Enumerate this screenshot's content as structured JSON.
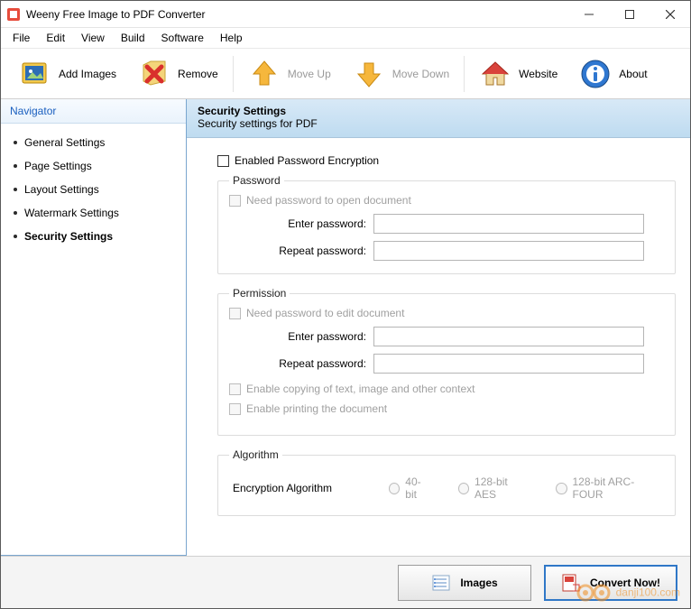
{
  "window": {
    "title": "Weeny Free Image to PDF Converter"
  },
  "menu": {
    "items": [
      "File",
      "Edit",
      "View",
      "Build",
      "Software",
      "Help"
    ]
  },
  "toolbar": {
    "add": "Add Images",
    "remove": "Remove",
    "moveup": "Move Up",
    "movedown": "Move Down",
    "website": "Website",
    "about": "About"
  },
  "sidebar": {
    "header": "Navigator",
    "items": [
      "General Settings",
      "Page Settings",
      "Layout Settings",
      "Watermark Settings",
      "Security Settings"
    ],
    "active": 4
  },
  "panel": {
    "title": "Security Settings",
    "subtitle": "Security settings for PDF",
    "enable_encryption": "Enabled Password Encryption",
    "password": {
      "legend": "Password",
      "need_open": "Need password to open document",
      "enter": "Enter password:",
      "repeat": "Repeat password:"
    },
    "permission": {
      "legend": "Permission",
      "need_edit": "Need password to edit document",
      "enter": "Enter password:",
      "repeat": "Repeat password:",
      "copy": "Enable copying of text, image and other context",
      "print": "Enable printing the document"
    },
    "algorithm": {
      "legend": "Algorithm",
      "label": "Encryption Algorithm",
      "options": [
        "40-bit",
        "128-bit AES",
        "128-bit ARC-FOUR"
      ]
    }
  },
  "footer": {
    "images": "Images",
    "convert": "Convert Now!"
  },
  "watermark": "danji100.com"
}
